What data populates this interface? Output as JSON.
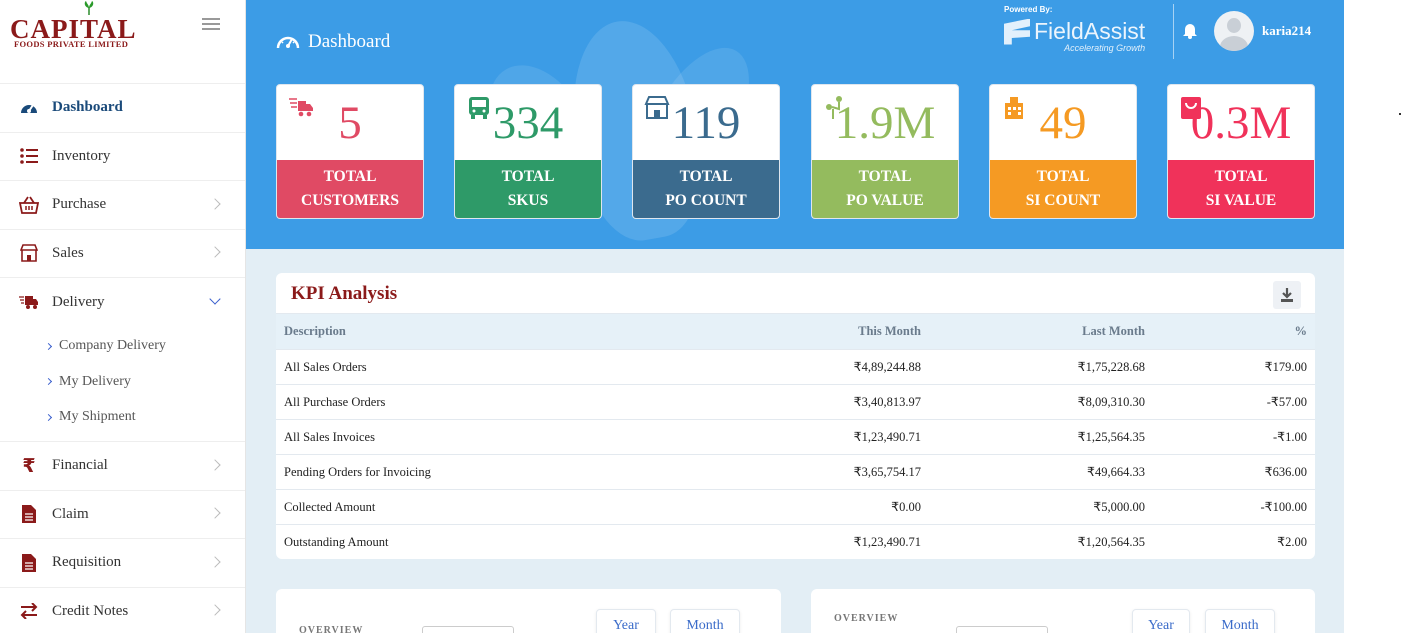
{
  "brand": {
    "name": "CAPITAL",
    "subtitle": "FOODS PRIVATE LIMITED",
    "color": "#8b1a1a"
  },
  "sidebar": {
    "items": [
      {
        "label": "Dashboard",
        "icon": "gauge-icon",
        "active": true
      },
      {
        "label": "Inventory",
        "icon": "list-icon"
      },
      {
        "label": "Purchase",
        "icon": "basket-icon"
      },
      {
        "label": "Sales",
        "icon": "store-icon"
      },
      {
        "label": "Delivery",
        "icon": "truck-icon",
        "expanded": true
      },
      {
        "label": "Financial",
        "icon": "rupee-icon"
      },
      {
        "label": "Claim",
        "icon": "document-icon"
      },
      {
        "label": "Requisition",
        "icon": "document-icon"
      },
      {
        "label": "Credit Notes",
        "icon": "exchange-icon"
      }
    ],
    "delivery_subitems": [
      {
        "label": "Company Delivery"
      },
      {
        "label": "My Delivery"
      },
      {
        "label": "My Shipment"
      }
    ]
  },
  "header": {
    "title": "Dashboard",
    "powered_by": "Powered By:",
    "provider": "FieldAssist",
    "tagline": "Accelerating Growth",
    "username": "karia214",
    "banner_color": "#3c9ce6"
  },
  "cards": [
    {
      "value": "5",
      "line1": "TOTAL",
      "line2": "CUSTOMERS",
      "color": "#e04a64",
      "icon": "delivery-truck-icon"
    },
    {
      "value": "334",
      "line1": "TOTAL",
      "line2": "SKUS",
      "color": "#2e9a68",
      "icon": "bus-icon"
    },
    {
      "value": "119",
      "line1": "TOTAL",
      "line2": "PO COUNT",
      "color": "#3b6b8e",
      "icon": "store-icon"
    },
    {
      "value": "1.9M",
      "line1": "TOTAL",
      "line2": "PO VALUE",
      "color": "#94bb5e",
      "icon": "growth-icon"
    },
    {
      "value": "49",
      "line1": "TOTAL",
      "line2": "SI COUNT",
      "color": "#f59a23",
      "icon": "building-icon"
    },
    {
      "value": "0.3M",
      "line1": "TOTAL",
      "line2": "SI VALUE",
      "color": "#f0325a",
      "icon": "shopping-bag-icon"
    }
  ],
  "kpi": {
    "title": "KPI Analysis",
    "columns": [
      "Description",
      "This Month",
      "Last Month",
      "%"
    ],
    "rows": [
      [
        "All Sales Orders",
        "₹4,89,244.88",
        "₹1,75,228.68",
        "₹179.00"
      ],
      [
        "All Purchase Orders",
        "₹3,40,813.97",
        "₹8,09,310.30",
        "-₹57.00"
      ],
      [
        "All Sales Invoices",
        "₹1,23,490.71",
        "₹1,25,564.35",
        "-₹1.00"
      ],
      [
        "Pending Orders for Invoicing",
        "₹3,65,754.17",
        "₹49,664.33",
        "₹636.00"
      ],
      [
        "Collected Amount",
        "₹0.00",
        "₹5,000.00",
        "-₹100.00"
      ],
      [
        "Outstanding Amount",
        "₹1,23,490.71",
        "₹1,20,564.35",
        "₹2.00"
      ]
    ]
  },
  "overview_left": {
    "label": "OVERVIEW",
    "year": "Year",
    "month": "Month"
  },
  "overview_right": {
    "label": "OVERVIEW",
    "year": "Year",
    "month": "Month"
  }
}
